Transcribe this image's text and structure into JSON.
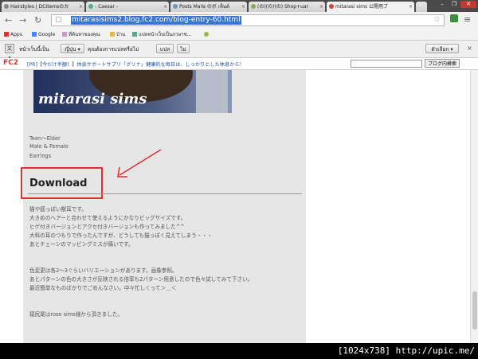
{
  "tabs": [
    {
      "title": "Hairstyles | DCItemsのカ",
      "color": "#888"
    },
    {
      "title": "- Caesar -",
      "color": "#5a9"
    },
    {
      "title": "Posts MaYa のボ เซ็นต์",
      "color": "#69b"
    },
    {
      "title": "(の)(の)(の) Shop+uar",
      "color": "#8a5"
    },
    {
      "title": "mitarasi sims 公開用ブ",
      "color": "#c44"
    }
  ],
  "url": "mitarasisims2.blog.fc2.com/blog-entry-60.html",
  "bookmarks": [
    {
      "label": "Apps",
      "color": "#d33"
    },
    {
      "label": "Google",
      "color": "#48f"
    },
    {
      "label": "ที่ค้นหาของคุณ",
      "color": "#c9c"
    },
    {
      "label": "บ้าน",
      "color": "#e9b84a"
    },
    {
      "label": "แปลหน้าเว็บเป็นภาษาซ...",
      "color": "#5a8"
    },
    {
      "label": "",
      "color": "#9b4"
    }
  ],
  "translate_bar": {
    "prompt": "หน้าเว็บนี้เป็น",
    "language": "ญี่ปุ่น",
    "question": "คุณต้องการแปลหรือไม่",
    "translate_button": "แปล",
    "no_button": "ไม่",
    "options_button": "ตัวเลือก"
  },
  "fc2": {
    "logo": "FC2",
    "ad_text": "[PR]【今だけ半額！】休息サポートサプリ「グリナ」健康的な毎日は、しっかりとした休息から！",
    "search_button": "ブログ内検索",
    "search_value": ""
  },
  "banner_title": "mitarasi sims",
  "item_info": [
    "Teen〜Elder",
    "Male &  Female",
    "Earrings"
  ],
  "download_heading": "Download",
  "paragraph1": [
    "猫や狐っぽい獣耳です。",
    "大きめのヘアーと合わせて使えるようにかなりビッグサイズです。",
    "ヒゲ付きバージョンとアクセ付きバージョンも作ってみました^^",
    "大科の耳のつもりで作ったんですが、どうしても猫っぽく見えてしまう・・・",
    "あとチェーンのマッピングミスが痛いです。"
  ],
  "paragraph2": [
    "色変更は各2〜3ぐらいバリエーションがあります。画像参照。",
    "あとパターンの色の大きさが反映される倍率も2パターン用意したので色々試してみて下さい。",
    "最近簡単なものばかりでごめんなさい。中々忙しくって＞＿＜"
  ],
  "credit": "猿尻尾はrose sims様から頂きました。",
  "watermark": "[1024x738] http://upic.me/"
}
